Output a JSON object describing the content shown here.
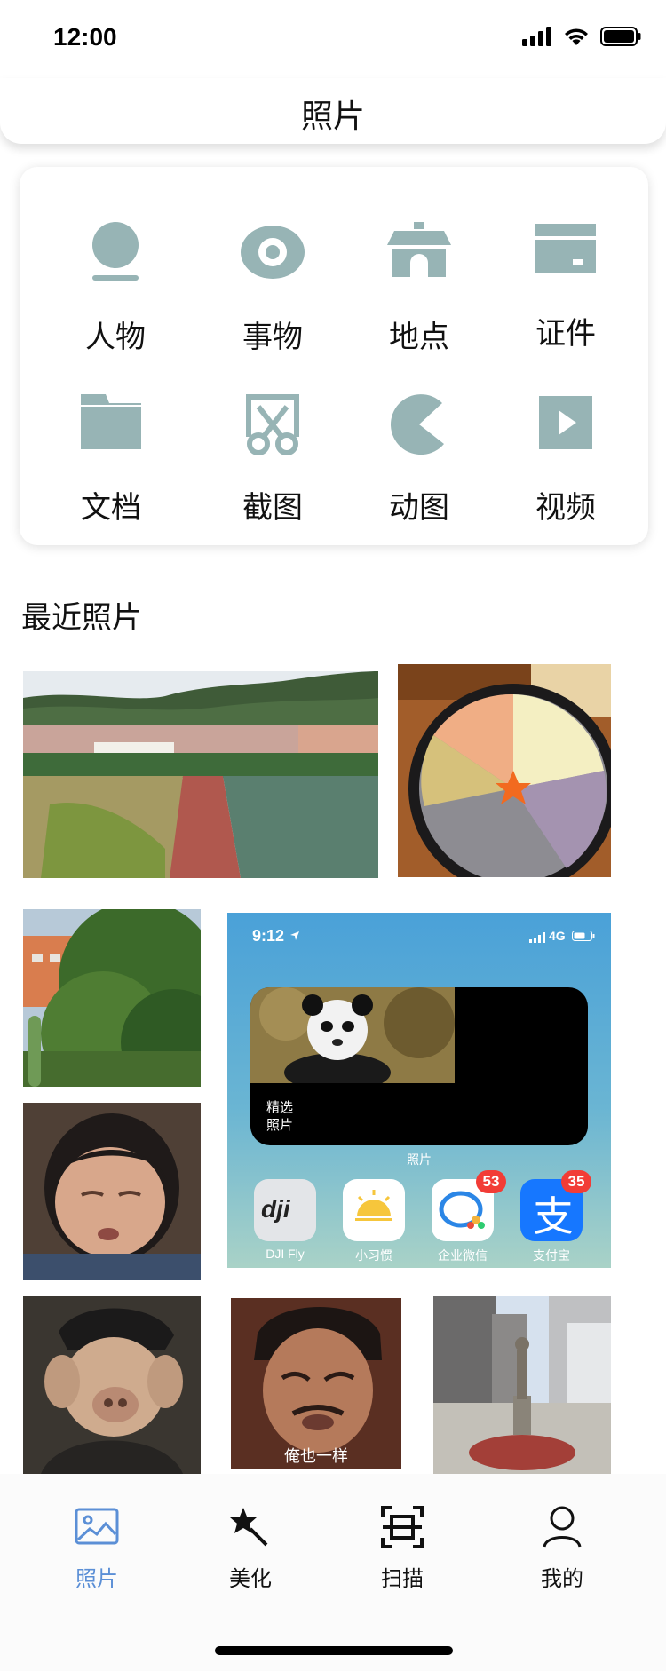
{
  "status": {
    "time": "12:00"
  },
  "nav": {
    "title": "照片"
  },
  "categories": [
    {
      "label": "人物",
      "icon": "person-icon"
    },
    {
      "label": "事物",
      "icon": "eye-icon"
    },
    {
      "label": "地点",
      "icon": "pavilion-icon"
    },
    {
      "label": "证件",
      "icon": "id-card-icon"
    },
    {
      "label": "文档",
      "icon": "folder-icon"
    },
    {
      "label": "截图",
      "icon": "scissors-icon"
    },
    {
      "label": "动图",
      "icon": "pacman-icon"
    },
    {
      "label": "视频",
      "icon": "play-icon"
    }
  ],
  "recent": {
    "title": "最近照片",
    "screenshot": {
      "time": "9:12",
      "network": "4G",
      "widget_label_1": "精选",
      "widget_label_2": "照片",
      "widget_caption": "照片",
      "apps": [
        {
          "name": "DJI Fly",
          "badge": ""
        },
        {
          "name": "小习惯",
          "badge": ""
        },
        {
          "name": "企业微信",
          "badge": "53"
        },
        {
          "name": "支付宝",
          "badge": "35"
        }
      ]
    },
    "meme_caption": "俺也一样"
  },
  "tabs": [
    {
      "label": "照片",
      "icon": "image-icon",
      "active": true
    },
    {
      "label": "美化",
      "icon": "magic-wand-icon",
      "active": false
    },
    {
      "label": "扫描",
      "icon": "scan-icon",
      "active": false
    },
    {
      "label": "我的",
      "icon": "profile-icon",
      "active": false
    }
  ],
  "colors": {
    "icon": "#97b4b5",
    "accent": "#5b8fd6"
  }
}
